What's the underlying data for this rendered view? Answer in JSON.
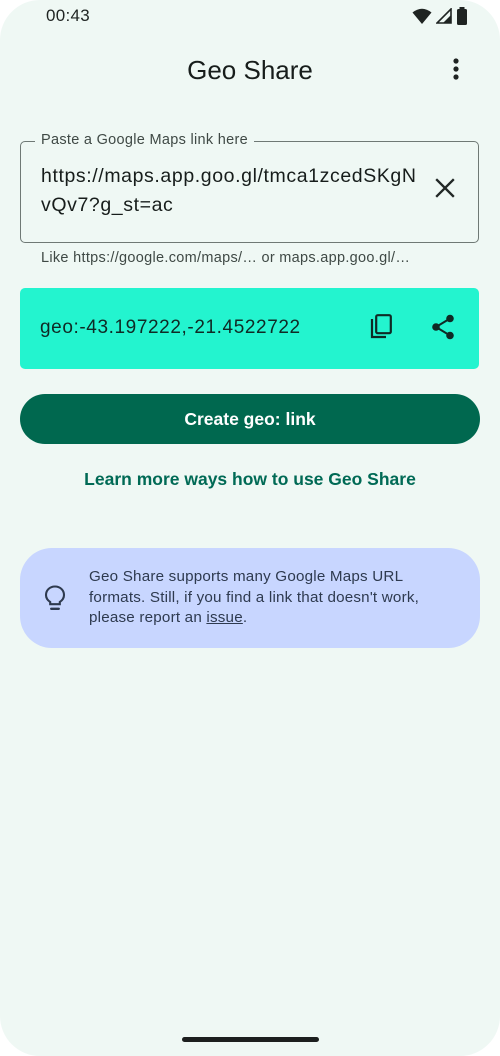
{
  "status_bar": {
    "time": "00:43",
    "icons": [
      "wifi-icon",
      "signal-icon",
      "battery-icon"
    ]
  },
  "app_bar": {
    "title": "Geo Share",
    "menu_icon": "more-vert-icon"
  },
  "link_input": {
    "label": "Paste a Google Maps link here",
    "value": "https://maps.app.goo.gl/tmca1zcedSKgNvQv7?g_st=ac",
    "clear_icon": "close-icon",
    "supporting_text": "Like https://google.com/maps/… or maps.app.goo.gl/…"
  },
  "result": {
    "geo_uri": "geo:-43.197222,-21.4522722",
    "copy_icon": "copy-icon",
    "share_icon": "share-icon",
    "background": "#23f4cf"
  },
  "actions": {
    "create_button": "Create geo: link",
    "learn_more_link": "Learn more ways how to use Geo Share"
  },
  "info_card": {
    "icon": "lightbulb-icon",
    "text_before_link": "Geo Share supports many Google Maps URL formats. Still, if you find a link that doesn't work, please report an ",
    "link_text": "issue",
    "text_after_link": "."
  },
  "colors": {
    "background": "#eff8f4",
    "primary": "#00684f",
    "link": "#006a55",
    "result_card": "#23f4cf",
    "info_card": "#c8d6ff"
  }
}
